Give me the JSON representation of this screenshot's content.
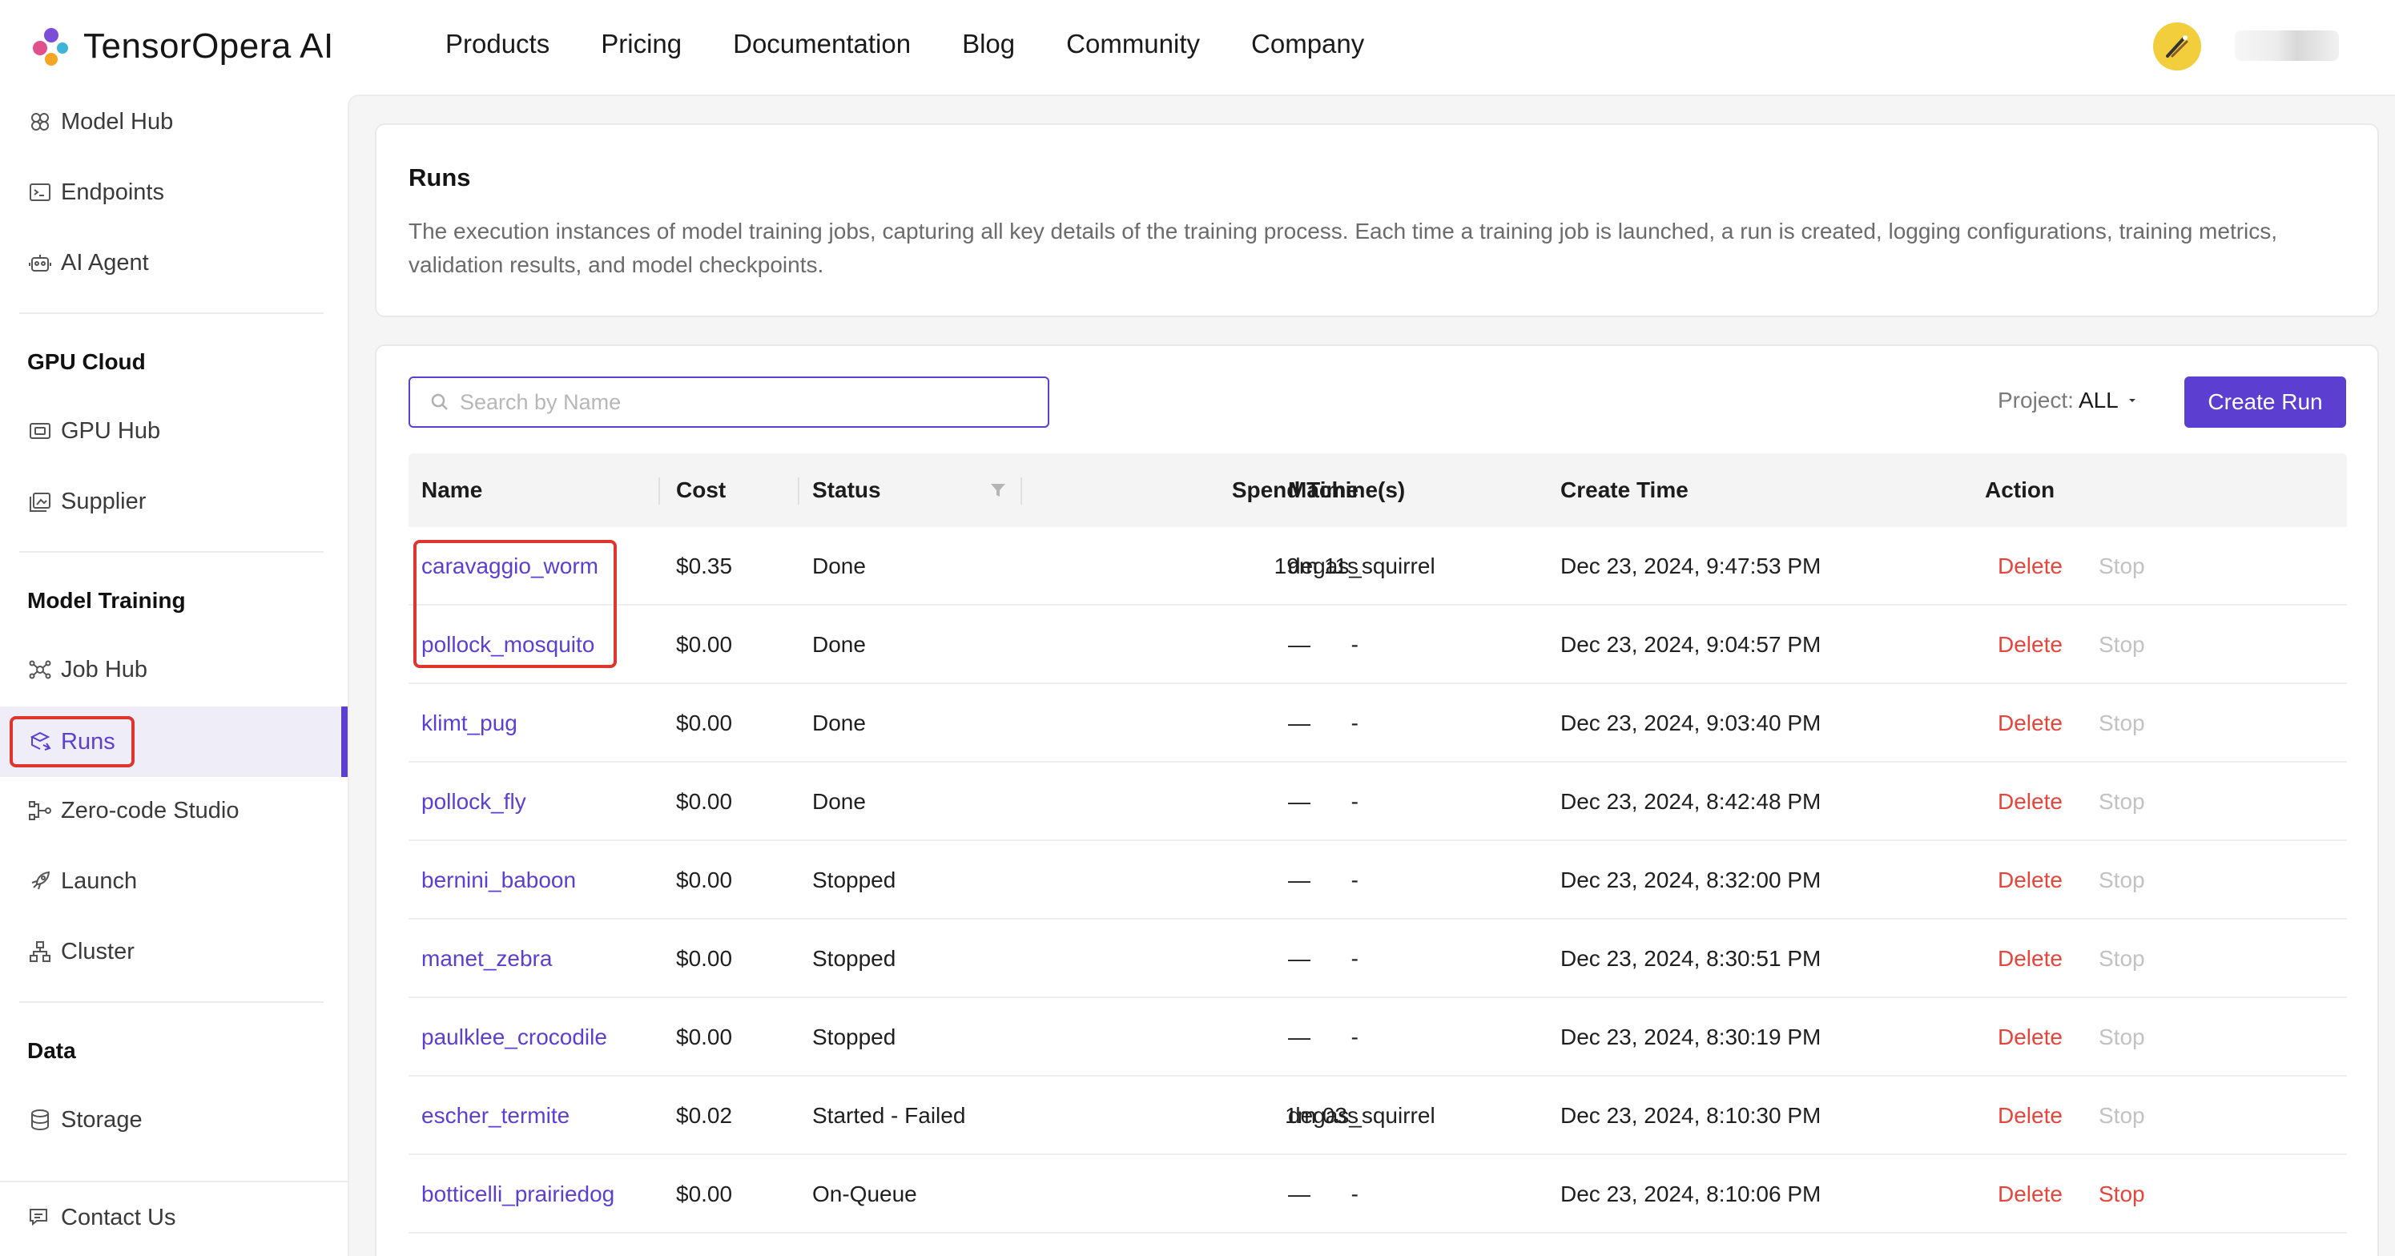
{
  "brand": {
    "name": "TensorOpera AI"
  },
  "nav": [
    "Products",
    "Pricing",
    "Documentation",
    "Blog",
    "Community",
    "Company"
  ],
  "sidebar": {
    "top_items": [
      {
        "label": "Model Hub",
        "icon": "model-hub-icon"
      },
      {
        "label": "Endpoints",
        "icon": "terminal-icon"
      },
      {
        "label": "AI Agent",
        "icon": "robot-icon"
      }
    ],
    "gpu_cloud": {
      "heading": "GPU Cloud",
      "items": [
        {
          "label": "GPU Hub",
          "icon": "gpu-icon"
        },
        {
          "label": "Supplier",
          "icon": "supplier-icon"
        }
      ]
    },
    "model_training": {
      "heading": "Model Training",
      "items": [
        {
          "label": "Job Hub",
          "icon": "network-icon"
        },
        {
          "label": "Runs",
          "icon": "runs-icon",
          "active": true
        },
        {
          "label": "Zero-code Studio",
          "icon": "flow-icon"
        },
        {
          "label": "Launch",
          "icon": "rocket-icon"
        },
        {
          "label": "Cluster",
          "icon": "cluster-icon"
        }
      ]
    },
    "data": {
      "heading": "Data",
      "items": [
        {
          "label": "Storage",
          "icon": "database-icon"
        }
      ]
    },
    "footer": {
      "label": "Contact Us",
      "icon": "chat-icon"
    }
  },
  "intro": {
    "title": "Runs",
    "description": "The execution instances of model training jobs, capturing all key details of the training process. Each time a training job is launched, a run is created, logging configurations, training metrics, validation results, and model checkpoints."
  },
  "toolbar": {
    "search_placeholder": "Search by Name",
    "project_label": "Project:",
    "project_value": "ALL",
    "create_button": "Create Run"
  },
  "table": {
    "columns": {
      "name": "Name",
      "cost": "Cost",
      "status": "Status",
      "spend_time": "Spend Time",
      "machines": "Machine(s)",
      "create_time": "Create Time",
      "action": "Action"
    },
    "action_labels": {
      "delete": "Delete",
      "stop": "Stop"
    },
    "rows": [
      {
        "name": "caravaggio_worm",
        "cost": "$0.35",
        "status": "Done",
        "spend_time": "19m 11s",
        "machines": "degas_squirrel",
        "create_time": "Dec 23, 2024, 9:47:53 PM",
        "stop_enabled": false
      },
      {
        "name": "pollock_mosquito",
        "cost": "$0.00",
        "status": "Done",
        "spend_time": "-",
        "machines": "—",
        "create_time": "Dec 23, 2024, 9:04:57 PM",
        "stop_enabled": false
      },
      {
        "name": "klimt_pug",
        "cost": "$0.00",
        "status": "Done",
        "spend_time": "-",
        "machines": "—",
        "create_time": "Dec 23, 2024, 9:03:40 PM",
        "stop_enabled": false
      },
      {
        "name": "pollock_fly",
        "cost": "$0.00",
        "status": "Done",
        "spend_time": "-",
        "machines": "—",
        "create_time": "Dec 23, 2024, 8:42:48 PM",
        "stop_enabled": false
      },
      {
        "name": "bernini_baboon",
        "cost": "$0.00",
        "status": "Stopped",
        "spend_time": "-",
        "machines": "—",
        "create_time": "Dec 23, 2024, 8:32:00 PM",
        "stop_enabled": false
      },
      {
        "name": "manet_zebra",
        "cost": "$0.00",
        "status": "Stopped",
        "spend_time": "-",
        "machines": "—",
        "create_time": "Dec 23, 2024, 8:30:51 PM",
        "stop_enabled": false
      },
      {
        "name": "paulklee_crocodile",
        "cost": "$0.00",
        "status": "Stopped",
        "spend_time": "-",
        "machines": "—",
        "create_time": "Dec 23, 2024, 8:30:19 PM",
        "stop_enabled": false
      },
      {
        "name": "escher_termite",
        "cost": "$0.02",
        "status": "Started - Failed",
        "spend_time": "1m 03s",
        "machines": "degas_squirrel",
        "create_time": "Dec 23, 2024, 8:10:30 PM",
        "stop_enabled": false
      },
      {
        "name": "botticelli_prairiedog",
        "cost": "$0.00",
        "status": "On-Queue",
        "spend_time": "-",
        "machines": "—",
        "create_time": "Dec 23, 2024, 8:10:06 PM",
        "stop_enabled": true
      }
    ]
  },
  "colors": {
    "accent": "#5c3fd0",
    "danger": "#e5453b",
    "disabled": "#c2c2c2",
    "annotation": "#e0342e"
  }
}
